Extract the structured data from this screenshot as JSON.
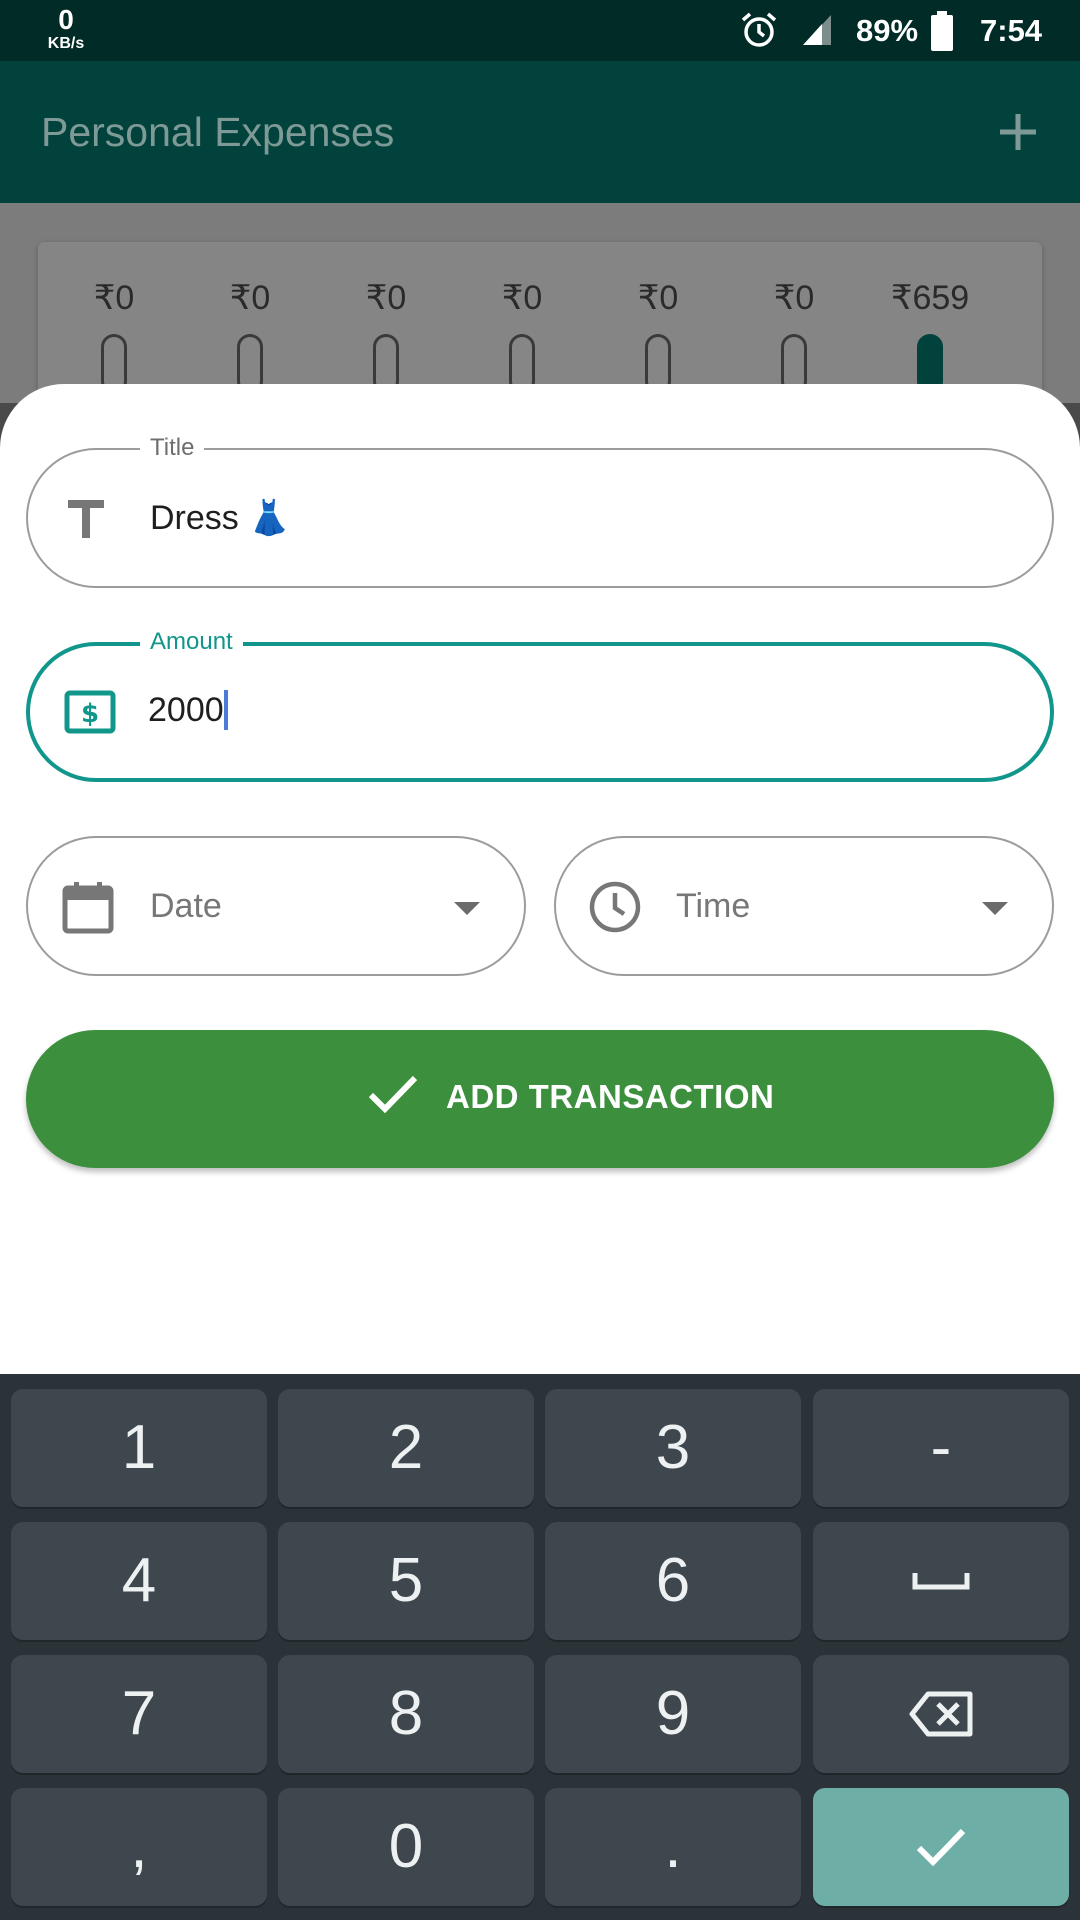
{
  "status_bar": {
    "net_speed_value": "0",
    "net_speed_unit": "KB/s",
    "battery": "89%",
    "time": "7:54"
  },
  "app_bar": {
    "title": "Personal Expenses"
  },
  "weekly_chart": {
    "labels": [
      "₹0",
      "₹0",
      "₹0",
      "₹0",
      "₹0",
      "₹0",
      "₹659"
    ],
    "fill_fractions": [
      0,
      0,
      0,
      0,
      0,
      0,
      1
    ]
  },
  "form": {
    "title_field": {
      "label": "Title",
      "value": "Dress 👗"
    },
    "amount_field": {
      "label": "Amount",
      "value": "2000"
    },
    "date_field": {
      "placeholder": "Date"
    },
    "time_field": {
      "placeholder": "Time"
    },
    "submit_label": "ADD TRANSACTION"
  },
  "keyboard": {
    "keys": [
      "1",
      "2",
      "3",
      "-",
      "4",
      "5",
      "6",
      "␣",
      "7",
      "8",
      "9",
      "⌫",
      ",",
      "0",
      ".",
      "✓"
    ]
  },
  "colors": {
    "status_bar": "#012b27",
    "app_bar": "#01433c",
    "accent": "#10968a",
    "button": "#3b8f3d",
    "keyboard_bg": "#2b3338",
    "key_bg": "#3e474d",
    "key_action": "#6daea7"
  }
}
